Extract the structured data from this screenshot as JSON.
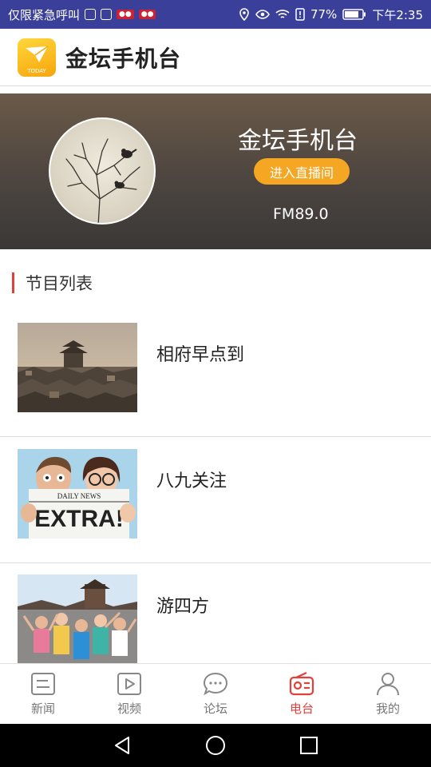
{
  "status_bar": {
    "left_text": "仅限紧急呼叫",
    "battery": "77%",
    "time": "下午2:35"
  },
  "header": {
    "logo_text": "TODAY",
    "title": "金坛手机台"
  },
  "banner": {
    "station_name": "金坛手机台",
    "live_button": "进入直播间",
    "frequency": "FM89.0"
  },
  "section": {
    "title": "节目列表"
  },
  "programs": [
    {
      "name": "相府早点到",
      "thumb": "town-rooftops"
    },
    {
      "name": "八九关注",
      "thumb": "extra-newspaper"
    },
    {
      "name": "游四方",
      "thumb": "tourists-pagoda"
    }
  ],
  "thumb_texts": {
    "daily_news": "DAILY NEWS",
    "extra": "EXTRA!"
  },
  "tabs": [
    {
      "label": "新闻",
      "icon": "news-icon",
      "active": false
    },
    {
      "label": "视频",
      "icon": "video-icon",
      "active": false
    },
    {
      "label": "论坛",
      "icon": "forum-icon",
      "active": false
    },
    {
      "label": "电台",
      "icon": "radio-icon",
      "active": true
    },
    {
      "label": "我的",
      "icon": "user-icon",
      "active": false
    }
  ],
  "colors": {
    "status_bar": "#3a3f9a",
    "accent": "#e0413a",
    "live_button": "#f5a623"
  }
}
